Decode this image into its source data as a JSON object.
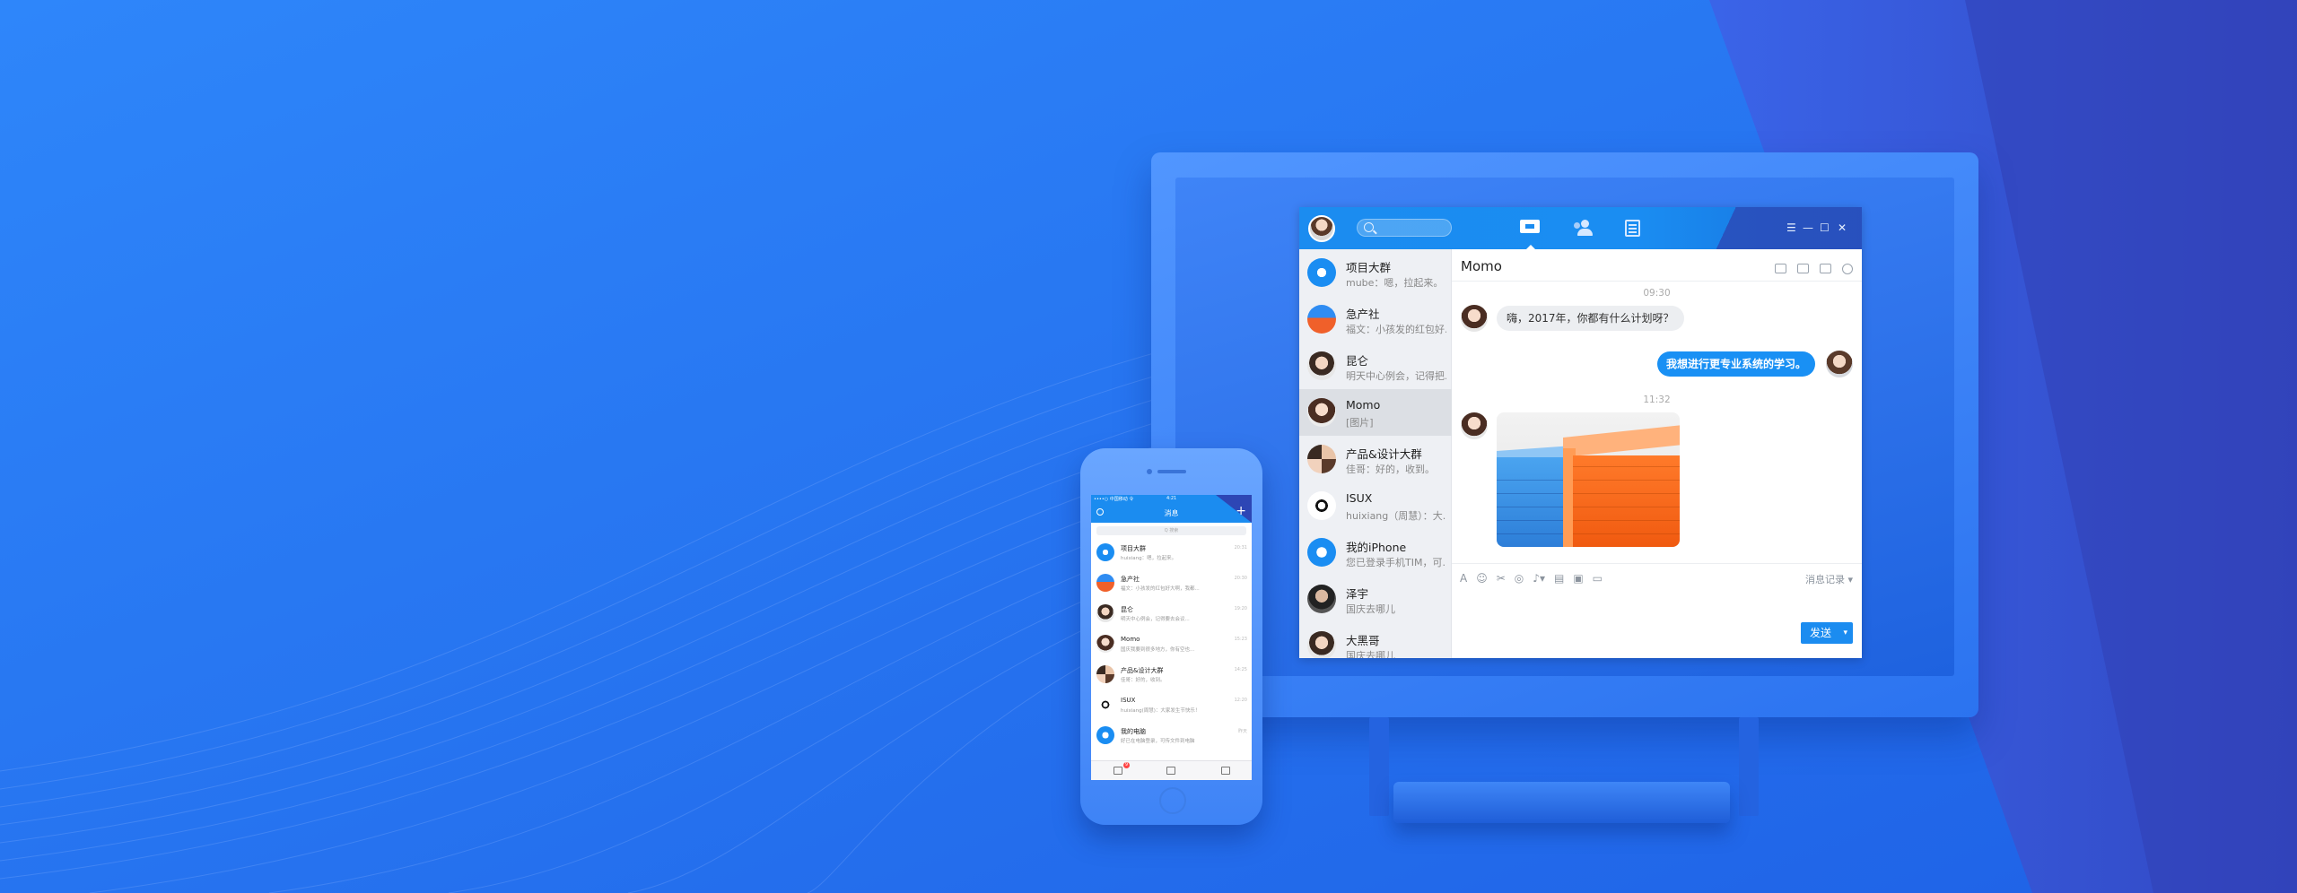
{
  "desktop": {
    "top_tabs": [
      "messages",
      "contacts",
      "docs"
    ],
    "window_controls": [
      "☰",
      "—",
      "☐",
      "✕"
    ],
    "conversations": [
      {
        "name": "项目大群",
        "preview": "mube：嗯，拉起来。",
        "avatar": "group-gear"
      },
      {
        "name": "急产社",
        "preview": "福文：小孩发的红包好...",
        "avatar": "blue-orange"
      },
      {
        "name": "昆仑",
        "preview": "明天中心例会，记得把...",
        "avatar": "person"
      },
      {
        "name": "Momo",
        "preview": "[图片]",
        "avatar": "woman",
        "selected": true
      },
      {
        "name": "产品&设计大群",
        "preview": "佳哥：好的，收到。",
        "avatar": "multi"
      },
      {
        "name": "ISUX",
        "preview": "huixiang（周慧）：大...",
        "avatar": "isux"
      },
      {
        "name": "我的iPhone",
        "preview": "您已登录手机TIM，可...",
        "avatar": "phone"
      },
      {
        "name": "泽宇",
        "preview": "国庆去哪儿",
        "avatar": "dark-person"
      },
      {
        "name": "大黑哥",
        "preview": "国庆去哪儿",
        "avatar": "person"
      }
    ],
    "chat": {
      "title": "Momo",
      "messages": [
        {
          "time": "09:30"
        },
        {
          "side": "left",
          "text": "嗨，2017年，你都有什么计划呀？"
        },
        {
          "side": "right",
          "text": "我想进行更专业系统的学习。"
        },
        {
          "time": "11:32"
        },
        {
          "side": "left",
          "type": "image"
        }
      ],
      "history_label": "消息记录 ▾",
      "send_label": "发送"
    }
  },
  "phone": {
    "status": "••••○ 中国移动 令",
    "clock": "4:21",
    "title": "消息",
    "search_placeholder": "Q 搜索",
    "rows": [
      {
        "name": "项目大群",
        "preview": "huixiang：嗯，拉起来。",
        "time": "20:31",
        "avatar": "group-gear"
      },
      {
        "name": "急产社",
        "preview": "福文：小孩发的红包好大啊，我都...",
        "time": "20:30",
        "avatar": "blue-orange"
      },
      {
        "name": "昆仑",
        "preview": "明天中心例会，记得要去会议...",
        "time": "19:20",
        "avatar": "person"
      },
      {
        "name": "Momo",
        "preview": "国庆我要到很多地方，你有空也...",
        "time": "15:23",
        "avatar": "woman"
      },
      {
        "name": "产品&设计大群",
        "preview": "佳哥：好的，收到。",
        "time": "14:25",
        "avatar": "multi"
      },
      {
        "name": "ISUX",
        "preview": "huixiang(周慧)：大家发生节快乐！",
        "time": "12:20",
        "avatar": "isux"
      },
      {
        "name": "我的电脑",
        "preview": "好已在电脑登录，可传文件到电脑",
        "time": "昨天",
        "avatar": "phone"
      }
    ],
    "badge": "9"
  }
}
